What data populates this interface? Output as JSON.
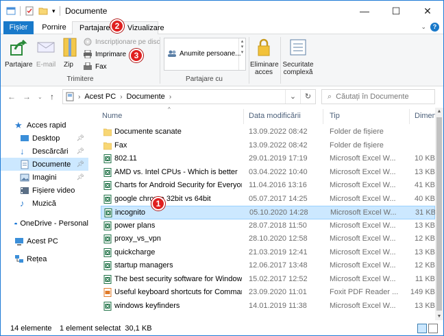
{
  "window": {
    "title": "Documente"
  },
  "tabs": {
    "file": "Fișier",
    "home": "Pornire",
    "share": "Partajare",
    "view": "Vizualizare"
  },
  "ribbon": {
    "share_button": "Partajare",
    "email_button": "E-mail",
    "zip_button": "Zip",
    "burn_button": "Inscripționare pe disc",
    "print_button": "Imprimare",
    "fax_button": "Fax",
    "group_send": "Trimitere",
    "specific_people": "Anumite persoane...",
    "group_share_with": "Partajare cu",
    "remove_access": "Eliminare acces",
    "advanced_security": "Securitate complexă"
  },
  "address": {
    "crumbs": [
      "Acest PC",
      "Documente"
    ],
    "search_placeholder": "Căutați în Documente"
  },
  "nav": {
    "quick_access": "Acces rapid",
    "items": [
      "Desktop",
      "Descărcări",
      "Documente",
      "Imagini",
      "Fișiere video",
      "Muzică"
    ],
    "onedrive": "OneDrive - Personal",
    "this_pc": "Acest PC",
    "network": "Rețea"
  },
  "columns": {
    "name": "Nume",
    "date": "Data modificării",
    "type": "Tip",
    "size": "Dimensiune"
  },
  "files": [
    {
      "name": "Documente scanate",
      "date": "13.09.2022 08:42",
      "type": "Folder de fișiere",
      "size": "",
      "kind": "folder"
    },
    {
      "name": "Fax",
      "date": "13.09.2022 08:42",
      "type": "Folder de fișiere",
      "size": "",
      "kind": "folder"
    },
    {
      "name": "802.11",
      "date": "29.01.2019 17:19",
      "type": "Microsoft Excel W...",
      "size": "10 KB",
      "kind": "excel"
    },
    {
      "name": "AMD vs. Intel CPUs - Which is better",
      "date": "03.04.2022 10:40",
      "type": "Microsoft Excel W...",
      "size": "13 KB",
      "kind": "excel"
    },
    {
      "name": "Charts for Android Security for Everyone",
      "date": "11.04.2016 13:16",
      "type": "Microsoft Excel W...",
      "size": "41 KB",
      "kind": "excel"
    },
    {
      "name": "google chrome 32bit vs 64bit",
      "date": "05.07.2017 14:25",
      "type": "Microsoft Excel W...",
      "size": "40 KB",
      "kind": "excel"
    },
    {
      "name": "incognito",
      "date": "05.10.2020 14:28",
      "type": "Microsoft Excel W...",
      "size": "31 KB",
      "kind": "excel"
    },
    {
      "name": "power plans",
      "date": "28.07.2018 11:50",
      "type": "Microsoft Excel W...",
      "size": "13 KB",
      "kind": "excel"
    },
    {
      "name": "proxy_vs_vpn",
      "date": "28.10.2020 12:58",
      "type": "Microsoft Excel W...",
      "size": "12 KB",
      "kind": "excel"
    },
    {
      "name": "quickcharge",
      "date": "21.03.2019 12:41",
      "type": "Microsoft Excel W...",
      "size": "13 KB",
      "kind": "excel"
    },
    {
      "name": "startup managers",
      "date": "12.06.2017 13:48",
      "type": "Microsoft Excel W...",
      "size": "12 KB",
      "kind": "excel"
    },
    {
      "name": "The best security software for Windows i...",
      "date": "15.02.2017 12:52",
      "type": "Microsoft Excel W...",
      "size": "11 KB",
      "kind": "excel"
    },
    {
      "name": "Useful keyboard shortcuts for Command...",
      "date": "23.09.2020 11:01",
      "type": "Foxit PDF Reader ...",
      "size": "149 KB",
      "kind": "pdf"
    },
    {
      "name": "windows keyfinders",
      "date": "14.01.2019 11:38",
      "type": "Microsoft Excel W...",
      "size": "13 KB",
      "kind": "excel"
    }
  ],
  "status": {
    "count": "14 elemente",
    "selection": "1 element selectat  30,1 KB"
  },
  "markers": [
    "1",
    "2",
    "3"
  ],
  "colors": {
    "accent": "#1979ca",
    "selection": "#cce8ff",
    "marker": "#e02020"
  }
}
